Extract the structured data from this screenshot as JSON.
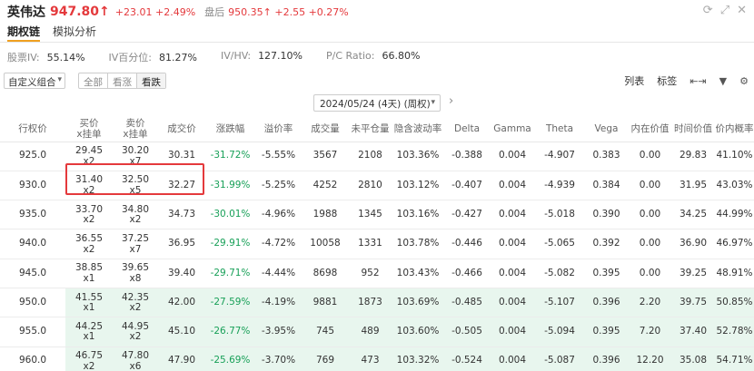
{
  "header": {
    "name": "英伟达",
    "price": "947.80↑",
    "change": "+23.01",
    "change_pct": "+2.49%",
    "after_label": "盘后",
    "after_price": "950.35↑",
    "after_change": "+2.55",
    "after_change_pct": "+0.27%",
    "icons": [
      "refresh-icon",
      "expand-icon",
      "close-icon"
    ]
  },
  "tabs": [
    {
      "label": "期权链",
      "active": true
    },
    {
      "label": "模拟分析",
      "active": false
    }
  ],
  "stats": [
    {
      "label": "股票IV:",
      "value": "55.14%"
    },
    {
      "label": "IV百分位:",
      "value": "81.27%"
    },
    {
      "label": "IV/HV:",
      "value": "127.10%"
    },
    {
      "label": "P/C Ratio:",
      "value": "66.80%"
    }
  ],
  "controls": {
    "combo": "自定义组合",
    "segments": [
      "全部",
      "看涨",
      "看跌"
    ],
    "list_label": "列表",
    "tag_label": "标签",
    "date": "2024/05/24 (4天) (周权)"
  },
  "table": {
    "headers": [
      [
        "行权价",
        ""
      ],
      [
        "买价",
        "x挂单"
      ],
      [
        "卖价",
        "x挂单"
      ],
      [
        "成交价",
        ""
      ],
      [
        "涨跌幅",
        ""
      ],
      [
        "溢价率",
        ""
      ],
      [
        "成交量",
        ""
      ],
      [
        "未平仓量",
        ""
      ],
      [
        "隐含波动率",
        ""
      ],
      [
        "Delta",
        ""
      ],
      [
        "Gamma",
        ""
      ],
      [
        "Theta",
        ""
      ],
      [
        "Vega",
        ""
      ],
      [
        "内在价值",
        ""
      ],
      [
        "时间价值",
        ""
      ],
      [
        "价内概率",
        ""
      ]
    ],
    "rows": [
      {
        "strike": "925.0",
        "bid": "29.45",
        "bid_size": "x2",
        "ask": "30.20",
        "ask_size": "x7",
        "last": "30.31",
        "chg": "-31.72%",
        "prem": "-5.55%",
        "vol": "3567",
        "oi": "2108",
        "iv": "103.36%",
        "delta": "-0.388",
        "gamma": "0.004",
        "theta": "-4.907",
        "vega": "0.383",
        "intr": "0.00",
        "tv": "29.83",
        "prob": "41.10%"
      },
      {
        "strike": "930.0",
        "bid": "31.40",
        "bid_size": "x2",
        "ask": "32.50",
        "ask_size": "x5",
        "last": "32.27",
        "chg": "-31.99%",
        "prem": "-5.25%",
        "vol": "4252",
        "oi": "2810",
        "iv": "103.12%",
        "delta": "-0.407",
        "gamma": "0.004",
        "theta": "-4.939",
        "vega": "0.384",
        "intr": "0.00",
        "tv": "31.95",
        "prob": "43.03%"
      },
      {
        "strike": "935.0",
        "bid": "33.70",
        "bid_size": "x2",
        "ask": "34.80",
        "ask_size": "x2",
        "last": "34.73",
        "chg": "-30.01%",
        "prem": "-4.96%",
        "vol": "1988",
        "oi": "1345",
        "iv": "103.16%",
        "delta": "-0.427",
        "gamma": "0.004",
        "theta": "-5.018",
        "vega": "0.390",
        "intr": "0.00",
        "tv": "34.25",
        "prob": "44.99%"
      },
      {
        "strike": "940.0",
        "bid": "36.55",
        "bid_size": "x2",
        "ask": "37.25",
        "ask_size": "x7",
        "last": "36.95",
        "chg": "-29.91%",
        "prem": "-4.72%",
        "vol": "10058",
        "oi": "1331",
        "iv": "103.78%",
        "delta": "-0.446",
        "gamma": "0.004",
        "theta": "-5.065",
        "vega": "0.392",
        "intr": "0.00",
        "tv": "36.90",
        "prob": "46.97%"
      },
      {
        "strike": "945.0",
        "bid": "38.85",
        "bid_size": "x1",
        "ask": "39.65",
        "ask_size": "x8",
        "last": "39.40",
        "chg": "-29.71%",
        "prem": "-4.44%",
        "vol": "8698",
        "oi": "952",
        "iv": "103.43%",
        "delta": "-0.466",
        "gamma": "0.004",
        "theta": "-5.082",
        "vega": "0.395",
        "intr": "0.00",
        "tv": "39.25",
        "prob": "48.91%"
      },
      {
        "strike": "950.0",
        "bid": "41.55",
        "bid_size": "x1",
        "ask": "42.35",
        "ask_size": "x2",
        "last": "42.00",
        "chg": "-27.59%",
        "prem": "-4.19%",
        "vol": "9881",
        "oi": "1873",
        "iv": "103.69%",
        "delta": "-0.485",
        "gamma": "0.004",
        "theta": "-5.107",
        "vega": "0.396",
        "intr": "2.20",
        "tv": "39.75",
        "prob": "50.85%"
      },
      {
        "strike": "955.0",
        "bid": "44.25",
        "bid_size": "x1",
        "ask": "44.95",
        "ask_size": "x2",
        "last": "45.10",
        "chg": "-26.77%",
        "prem": "-3.95%",
        "vol": "745",
        "oi": "489",
        "iv": "103.60%",
        "delta": "-0.505",
        "gamma": "0.004",
        "theta": "-5.094",
        "vega": "0.395",
        "intr": "7.20",
        "tv": "37.40",
        "prob": "52.78%"
      },
      {
        "strike": "960.0",
        "bid": "46.75",
        "bid_size": "x2",
        "ask": "47.80",
        "ask_size": "x6",
        "last": "47.90",
        "chg": "-25.69%",
        "prem": "-3.70%",
        "vol": "769",
        "oi": "473",
        "iv": "103.32%",
        "delta": "-0.524",
        "gamma": "0.004",
        "theta": "-5.087",
        "vega": "0.396",
        "intr": "12.20",
        "tv": "35.08",
        "prob": "54.71%"
      }
    ],
    "itm_from_row": 5
  },
  "colors": {
    "up": "#e4393c",
    "down": "#18a058",
    "itm_bg": "#e8f6ee",
    "tab_accent": "#f0a020"
  }
}
